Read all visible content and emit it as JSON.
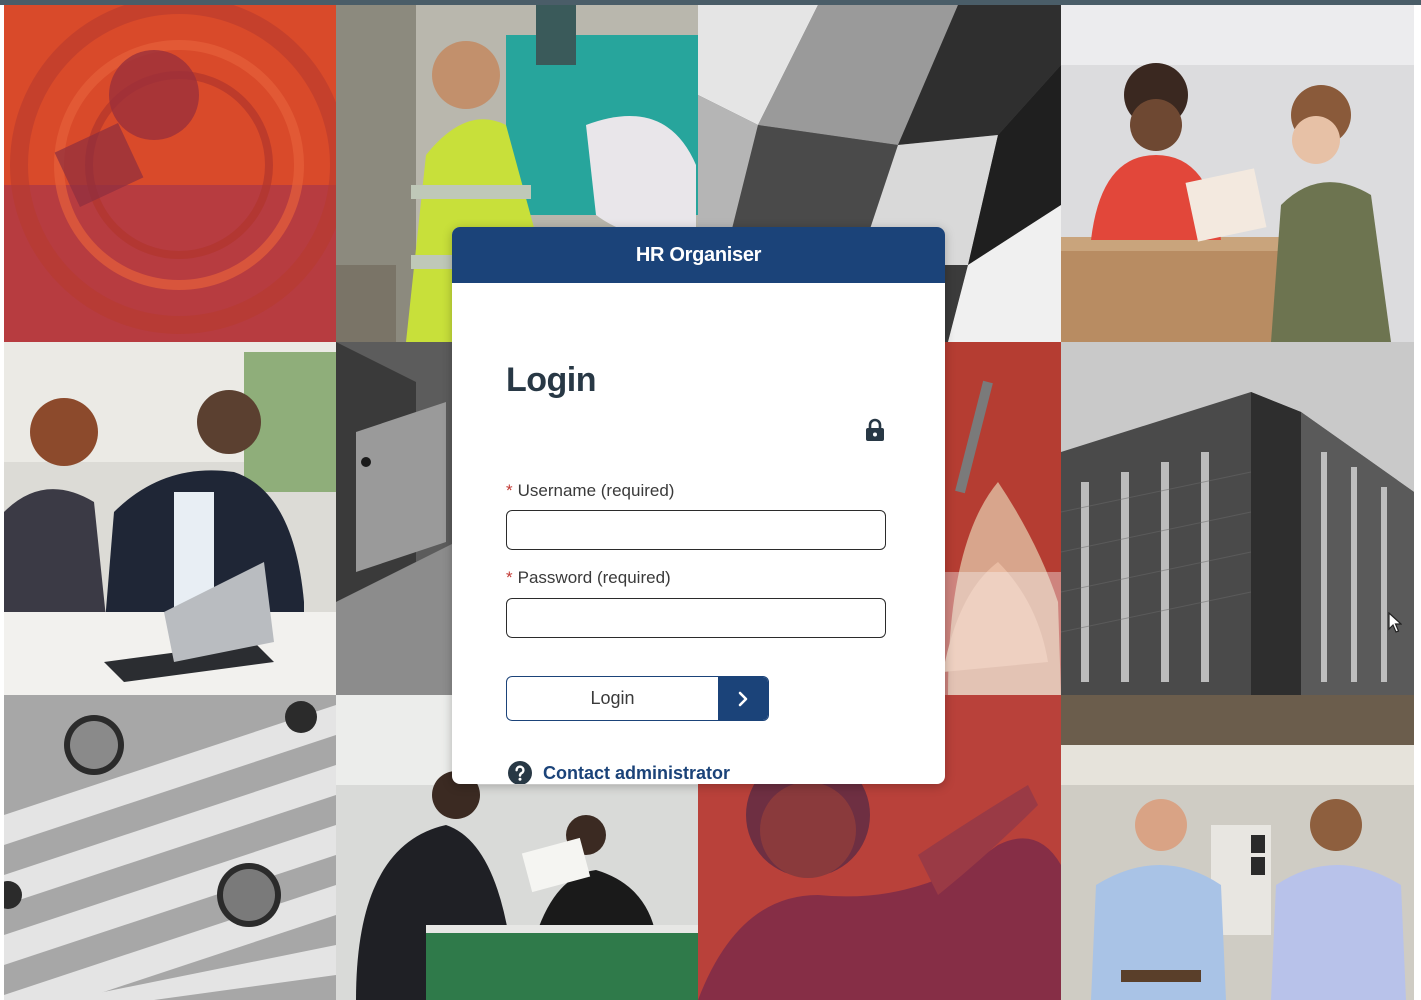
{
  "app": {
    "title": "HR Organiser"
  },
  "login": {
    "heading": "Login",
    "required_marker": "*",
    "username_label": "Username (required)",
    "username_value": "",
    "password_label": "Password (required)",
    "password_value": "",
    "submit_label": "Login",
    "contact_label": "Contact administrator"
  },
  "icons": {
    "lock": "lock-icon",
    "arrow": "chevron-right-icon",
    "help": "question-circle-icon"
  },
  "colors": {
    "header_bg": "#1b4379",
    "required": "#c23934",
    "accent": "#1b4379"
  }
}
